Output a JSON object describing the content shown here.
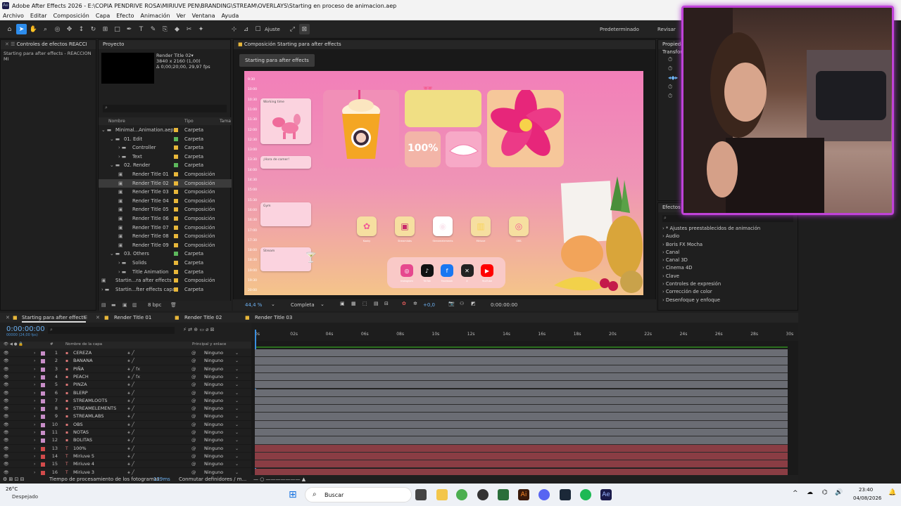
{
  "window": {
    "title": "Adobe After Effects 2026 - E:\\COPIA PENDRIVE ROSA\\MIRIUVE PEN\\BRANDING\\STREAM\\OVERLAYS\\Starting en proceso de animacion.aep"
  },
  "menu": [
    "Archivo",
    "Editar",
    "Composición",
    "Capa",
    "Efecto",
    "Animación",
    "Ver",
    "Ventana",
    "Ayuda"
  ],
  "toolbar": {
    "snap_label": "Ajuste",
    "workspace": "Predeterminado",
    "review": "Revisar"
  },
  "effects_panel": {
    "title": "Controles de efectos REACCI",
    "subtitle": "Starting para after effects - REACCION MI"
  },
  "project": {
    "title": "Proyecto",
    "selected_name": "Render Title 02▾",
    "selected_size": "3840 x 2160 (1,00)",
    "selected_duration": "Δ 0;00;20;00, 29,97 fps",
    "search_placeholder": "⌕",
    "col_name": "Nombre",
    "col_type": "Tipo",
    "col_size": "Tama",
    "bpc": "8 bpc",
    "items": [
      {
        "name": "Minimal...Animation.aep",
        "type": "Carpeta",
        "indent": 0,
        "color": "#e8b73a",
        "kind": "folder"
      },
      {
        "name": "01. Edit",
        "type": "Carpeta",
        "indent": 1,
        "color": "#5cb85c",
        "kind": "folder"
      },
      {
        "name": "Controller",
        "type": "Carpeta",
        "indent": 2,
        "color": "#e8b73a",
        "kind": "folder"
      },
      {
        "name": "Text",
        "type": "Carpeta",
        "indent": 2,
        "color": "#e8b73a",
        "kind": "folder"
      },
      {
        "name": "02. Render",
        "type": "Carpeta",
        "indent": 1,
        "color": "#5cb85c",
        "kind": "folder"
      },
      {
        "name": "Render Title 01",
        "type": "Composición",
        "indent": 2,
        "color": "#e8b73a",
        "kind": "comp"
      },
      {
        "name": "Render Title 02",
        "type": "Composición",
        "indent": 2,
        "color": "#e8b73a",
        "kind": "comp",
        "selected": true
      },
      {
        "name": "Render Title 03",
        "type": "Composición",
        "indent": 2,
        "color": "#e8b73a",
        "kind": "comp"
      },
      {
        "name": "Render Title 04",
        "type": "Composición",
        "indent": 2,
        "color": "#e8b73a",
        "kind": "comp"
      },
      {
        "name": "Render Title 05",
        "type": "Composición",
        "indent": 2,
        "color": "#e8b73a",
        "kind": "comp"
      },
      {
        "name": "Render Title 06",
        "type": "Composición",
        "indent": 2,
        "color": "#e8b73a",
        "kind": "comp"
      },
      {
        "name": "Render Title 07",
        "type": "Composición",
        "indent": 2,
        "color": "#e8b73a",
        "kind": "comp"
      },
      {
        "name": "Render Title 08",
        "type": "Composición",
        "indent": 2,
        "color": "#e8b73a",
        "kind": "comp"
      },
      {
        "name": "Render Title 09",
        "type": "Composición",
        "indent": 2,
        "color": "#e8b73a",
        "kind": "comp"
      },
      {
        "name": "03. Others",
        "type": "Carpeta",
        "indent": 1,
        "color": "#5cb85c",
        "kind": "folder"
      },
      {
        "name": "Solids",
        "type": "Carpeta",
        "indent": 2,
        "color": "#e8b73a",
        "kind": "folder"
      },
      {
        "name": "Title Animation",
        "type": "Carpeta",
        "indent": 2,
        "color": "#e8b73a",
        "kind": "folder"
      },
      {
        "name": "Startin...ra after effects",
        "type": "Composición",
        "indent": 0,
        "color": "#e8b73a",
        "kind": "comp"
      },
      {
        "name": "Startin...fter effects capas",
        "type": "Carpeta",
        "indent": 0,
        "color": "#e8b73a",
        "kind": "folder"
      }
    ]
  },
  "composition": {
    "panel_title": "Composición Starting para after effects",
    "tab": "Starting para after effects",
    "zoom": "44,4 %",
    "resolution": "Completa",
    "exposure": "+0,0",
    "timecode": "0:00:00:00",
    "times": [
      "9:30",
      "10:00",
      "10:30",
      "11:00",
      "11:30",
      "12:00",
      "12:30",
      "13:00",
      "13:30",
      "14:00",
      "14:30",
      "15:00",
      "15:30",
      "16:00",
      "16:30",
      "17:00",
      "17:30",
      "18:00",
      "18:30",
      "19:00",
      "19:30",
      "20:00"
    ],
    "cards": [
      "Working time",
      "¡Hora de comer!",
      "Gym",
      "Stream"
    ],
    "percent": "100%",
    "icon_labels": [
      "Kooky",
      "Streamlabs",
      "Streamelements",
      "Miriuve",
      "OBS"
    ],
    "socials": [
      "Instagram",
      "TikTok",
      "Facebook",
      "X",
      "YouTube"
    ]
  },
  "properties": {
    "title": "Propieda",
    "transform": "Transfor"
  },
  "effects_presets": {
    "title": "Efectos y",
    "items": [
      "* Ajustes preestablecidos de animación",
      "Audio",
      "Boris FX Mocha",
      "Canal",
      "Canal 3D",
      "Cinema 4D",
      "Clave",
      "Controles de expresión",
      "Corrección de color",
      "Desenfoque y enfoque"
    ]
  },
  "timeline": {
    "tabs": [
      "Starting para after effects",
      "Render Title 01",
      "Render Title 02",
      "Render Title 03"
    ],
    "timecode": "0:00:00:00",
    "fps": "00000 (24,00 fps)",
    "col_num": "#",
    "col_name": "Nombre de la capa",
    "col_parent": "Principal y enlace",
    "ruler": [
      "0s",
      "02s",
      "04s",
      "06s",
      "08s",
      "10s",
      "12s",
      "14s",
      "16s",
      "18s",
      "20s",
      "22s",
      "24s",
      "26s",
      "28s",
      "30s"
    ],
    "layers": [
      {
        "num": "1",
        "name": "CEREZA",
        "type": "img",
        "color": "#c88ec8",
        "parent": "Ninguno"
      },
      {
        "num": "2",
        "name": "BANANA",
        "type": "img",
        "color": "#c88ec8",
        "parent": "Ninguno"
      },
      {
        "num": "3",
        "name": "PIÑA",
        "type": "img",
        "color": "#c88ec8",
        "parent": "Ninguno",
        "fx": true
      },
      {
        "num": "4",
        "name": "PEACH",
        "type": "img",
        "color": "#c88ec8",
        "parent": "Ninguno",
        "fx": true
      },
      {
        "num": "5",
        "name": "PINZA",
        "type": "img",
        "color": "#c88ec8",
        "parent": "Ninguno"
      },
      {
        "num": "6",
        "name": "BLERP",
        "type": "img",
        "color": "#c88ec8",
        "parent": "Ninguno"
      },
      {
        "num": "7",
        "name": "STREAMLOOTS",
        "type": "img",
        "color": "#c88ec8",
        "parent": "Ninguno"
      },
      {
        "num": "8",
        "name": "STREAMELEMENTS",
        "type": "img",
        "color": "#c88ec8",
        "parent": "Ninguno"
      },
      {
        "num": "9",
        "name": "STREAMLABS",
        "type": "img",
        "color": "#c88ec8",
        "parent": "Ninguno"
      },
      {
        "num": "10",
        "name": "OBS",
        "type": "img",
        "color": "#c88ec8",
        "parent": "Ninguno"
      },
      {
        "num": "11",
        "name": "NOTAS",
        "type": "img",
        "color": "#c88ec8",
        "parent": "Ninguno"
      },
      {
        "num": "12",
        "name": "BOLITAS",
        "type": "img",
        "color": "#c88ec8",
        "parent": "Ninguno"
      },
      {
        "num": "13",
        "name": "100%",
        "type": "T",
        "color": "#d24b4b",
        "parent": "Ninguno"
      },
      {
        "num": "14",
        "name": "Miriuve 5",
        "type": "T",
        "color": "#d24b4b",
        "parent": "Ninguno"
      },
      {
        "num": "15",
        "name": "Miriuve 4",
        "type": "T",
        "color": "#d24b4b",
        "parent": "Ninguno"
      },
      {
        "num": "16",
        "name": "Miriuve 3",
        "type": "T",
        "color": "#d24b4b",
        "parent": "Ninguno"
      }
    ],
    "status_render": "Tiempo de procesamiento de los fotogramas:",
    "render_ms": "129ms",
    "status_toggle": "Conmutar definidores / m..."
  },
  "taskbar": {
    "weather_temp": "26°C",
    "weather_desc": "Despejado",
    "search": "Buscar",
    "time": "23:40",
    "date": "04/08/2026"
  },
  "colors": {
    "accent": "#2d8ceb",
    "webcam_border": "#c042d8"
  }
}
